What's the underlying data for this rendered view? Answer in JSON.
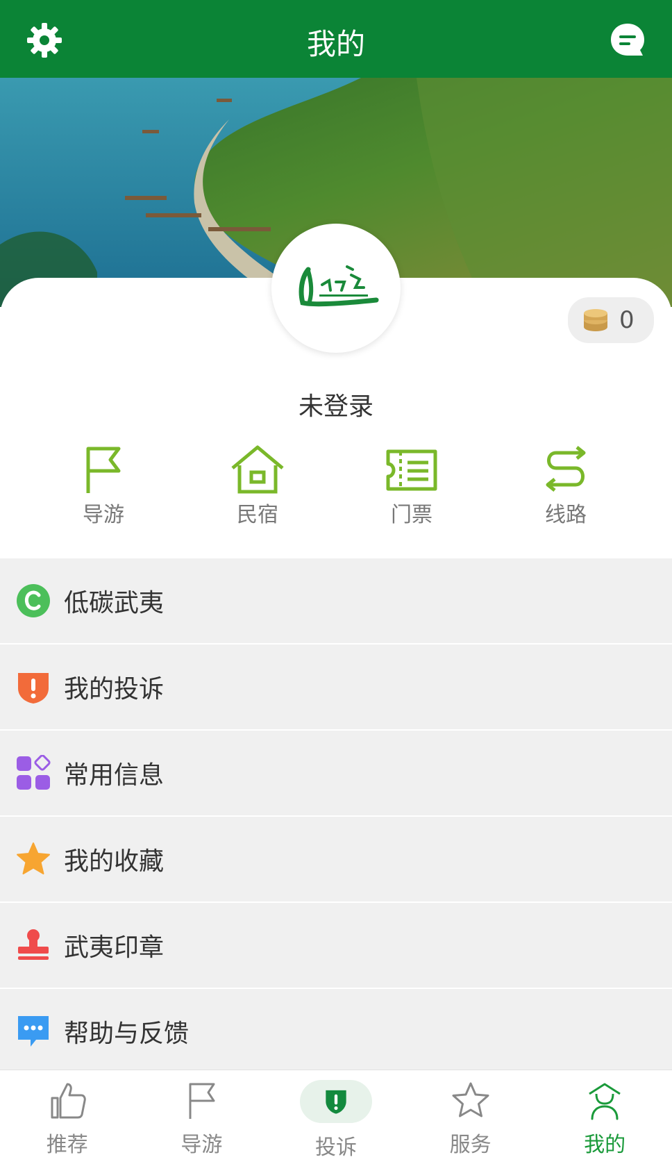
{
  "header": {
    "title": "我的"
  },
  "profile": {
    "login_text": "未登录",
    "coins": "0"
  },
  "quick_actions": [
    {
      "label": "导游",
      "icon": "flag-icon"
    },
    {
      "label": "民宿",
      "icon": "house-icon"
    },
    {
      "label": "门票",
      "icon": "ticket-icon"
    },
    {
      "label": "线路",
      "icon": "route-icon"
    }
  ],
  "menu": [
    {
      "label": "低碳武夷",
      "icon": "low-carbon-icon"
    },
    {
      "label": "我的投诉",
      "icon": "complaint-shield-icon"
    },
    {
      "label": "常用信息",
      "icon": "apps-grid-icon"
    },
    {
      "label": "我的收藏",
      "icon": "star-icon"
    },
    {
      "label": "武夷印章",
      "icon": "stamp-icon"
    },
    {
      "label": "帮助与反馈",
      "icon": "feedback-chat-icon"
    }
  ],
  "tabs": [
    {
      "label": "推荐",
      "icon": "thumbs-up-icon"
    },
    {
      "label": "导游",
      "icon": "flag-icon"
    },
    {
      "label": "投诉",
      "icon": "shield-alert-icon"
    },
    {
      "label": "服务",
      "icon": "star-icon"
    },
    {
      "label": "我的",
      "icon": "person-icon",
      "active": true
    }
  ],
  "colors": {
    "brand_green": "#0b8436",
    "active_tab": "#1a9a3a",
    "menu_bg": "#f0f0f0"
  }
}
